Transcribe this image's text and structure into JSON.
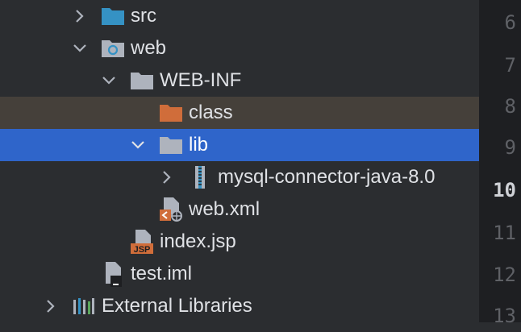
{
  "tree": {
    "items": [
      {
        "label": "src",
        "icon": "folder-source-icon",
        "expanded": false
      },
      {
        "label": "web",
        "icon": "folder-web-icon",
        "expanded": true
      },
      {
        "label": "WEB-INF",
        "icon": "folder-icon",
        "expanded": true
      },
      {
        "label": "class",
        "icon": "folder-excluded-icon"
      },
      {
        "label": "lib",
        "icon": "folder-icon",
        "expanded": true,
        "selected": true
      },
      {
        "label": "mysql-connector-java-8.0",
        "icon": "jar-archive-icon",
        "expanded": false
      },
      {
        "label": "web.xml",
        "icon": "xml-file-icon"
      },
      {
        "label": "index.jsp",
        "icon": "jsp-file-icon"
      },
      {
        "label": "test.iml",
        "icon": "iml-file-icon"
      },
      {
        "label": "External Libraries",
        "icon": "external-libraries-icon",
        "expanded": false
      }
    ]
  },
  "gutter": {
    "line_numbers": [
      "6",
      "7",
      "8",
      "9",
      "10",
      "11",
      "12",
      "13"
    ],
    "current_line": "10"
  },
  "colors": {
    "selection": "#2f65ca",
    "excluded_folder": "#d06d3a",
    "source_folder": "#3592c4",
    "folder": "#aeb3bd",
    "background": "#2b2d30"
  }
}
